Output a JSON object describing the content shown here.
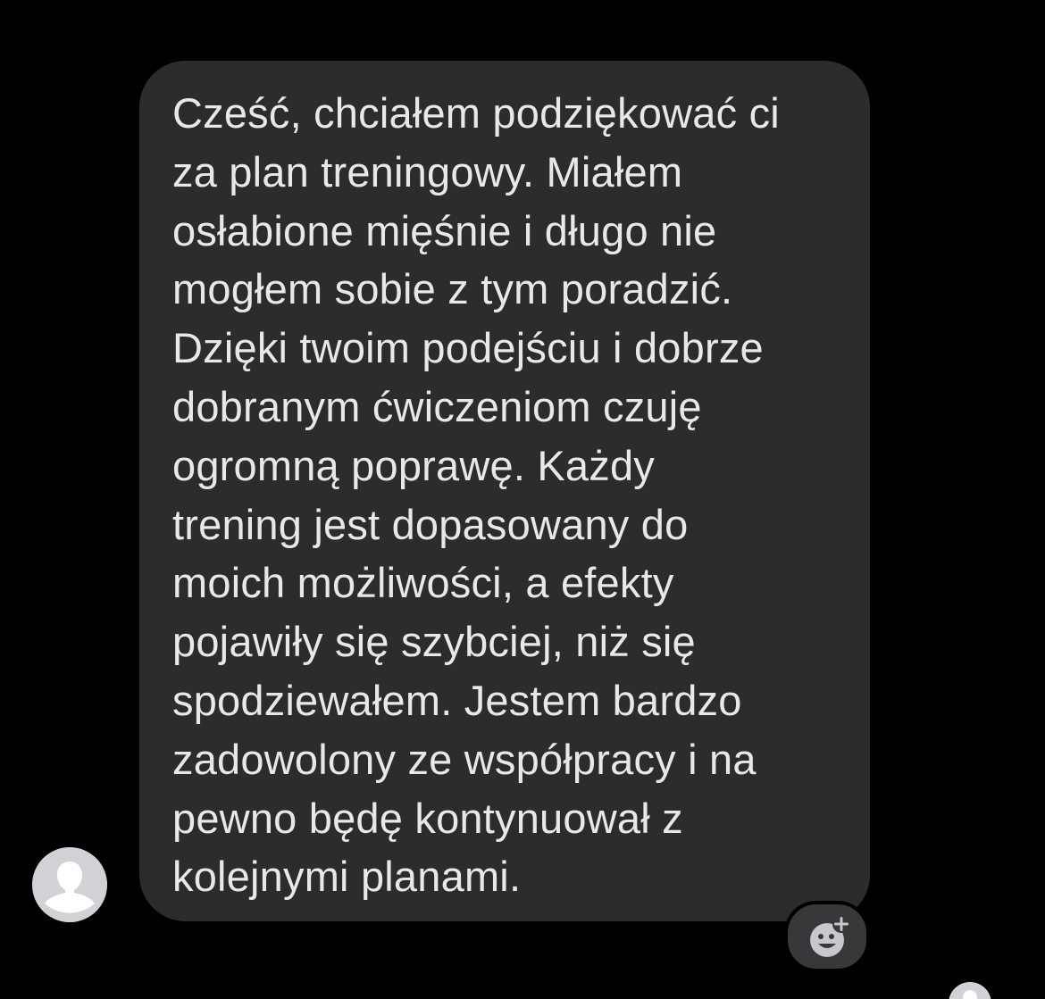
{
  "message": {
    "lines": [
      "Cześć, chciałem podziękować ci",
      "za plan treningowy. Miałem",
      "osłabione mięśnie i długo nie",
      "mogłem sobie z tym poradzić.",
      "Dzięki twoim podejściu i dobrze",
      "dobranym ćwiczeniom czuję",
      "ogromną poprawę. Każdy",
      "trening jest dopasowany do",
      "moich możliwości, a efekty",
      "pojawiły się szybciej, niż się",
      "spodziewałem. Jestem bardzo",
      "zadowolony ze współpracy i na",
      "pewno będę kontynuował z",
      "kolejnymi planami."
    ]
  },
  "icons": {
    "avatar": "person-silhouette-icon",
    "reaction": "add-reaction-icon",
    "read_receipt": "person-silhouette-icon"
  },
  "colors": {
    "background": "#000000",
    "bubble": "#2c2c2e",
    "text": "#e8e8ea",
    "avatar": "#d1d1d6"
  }
}
